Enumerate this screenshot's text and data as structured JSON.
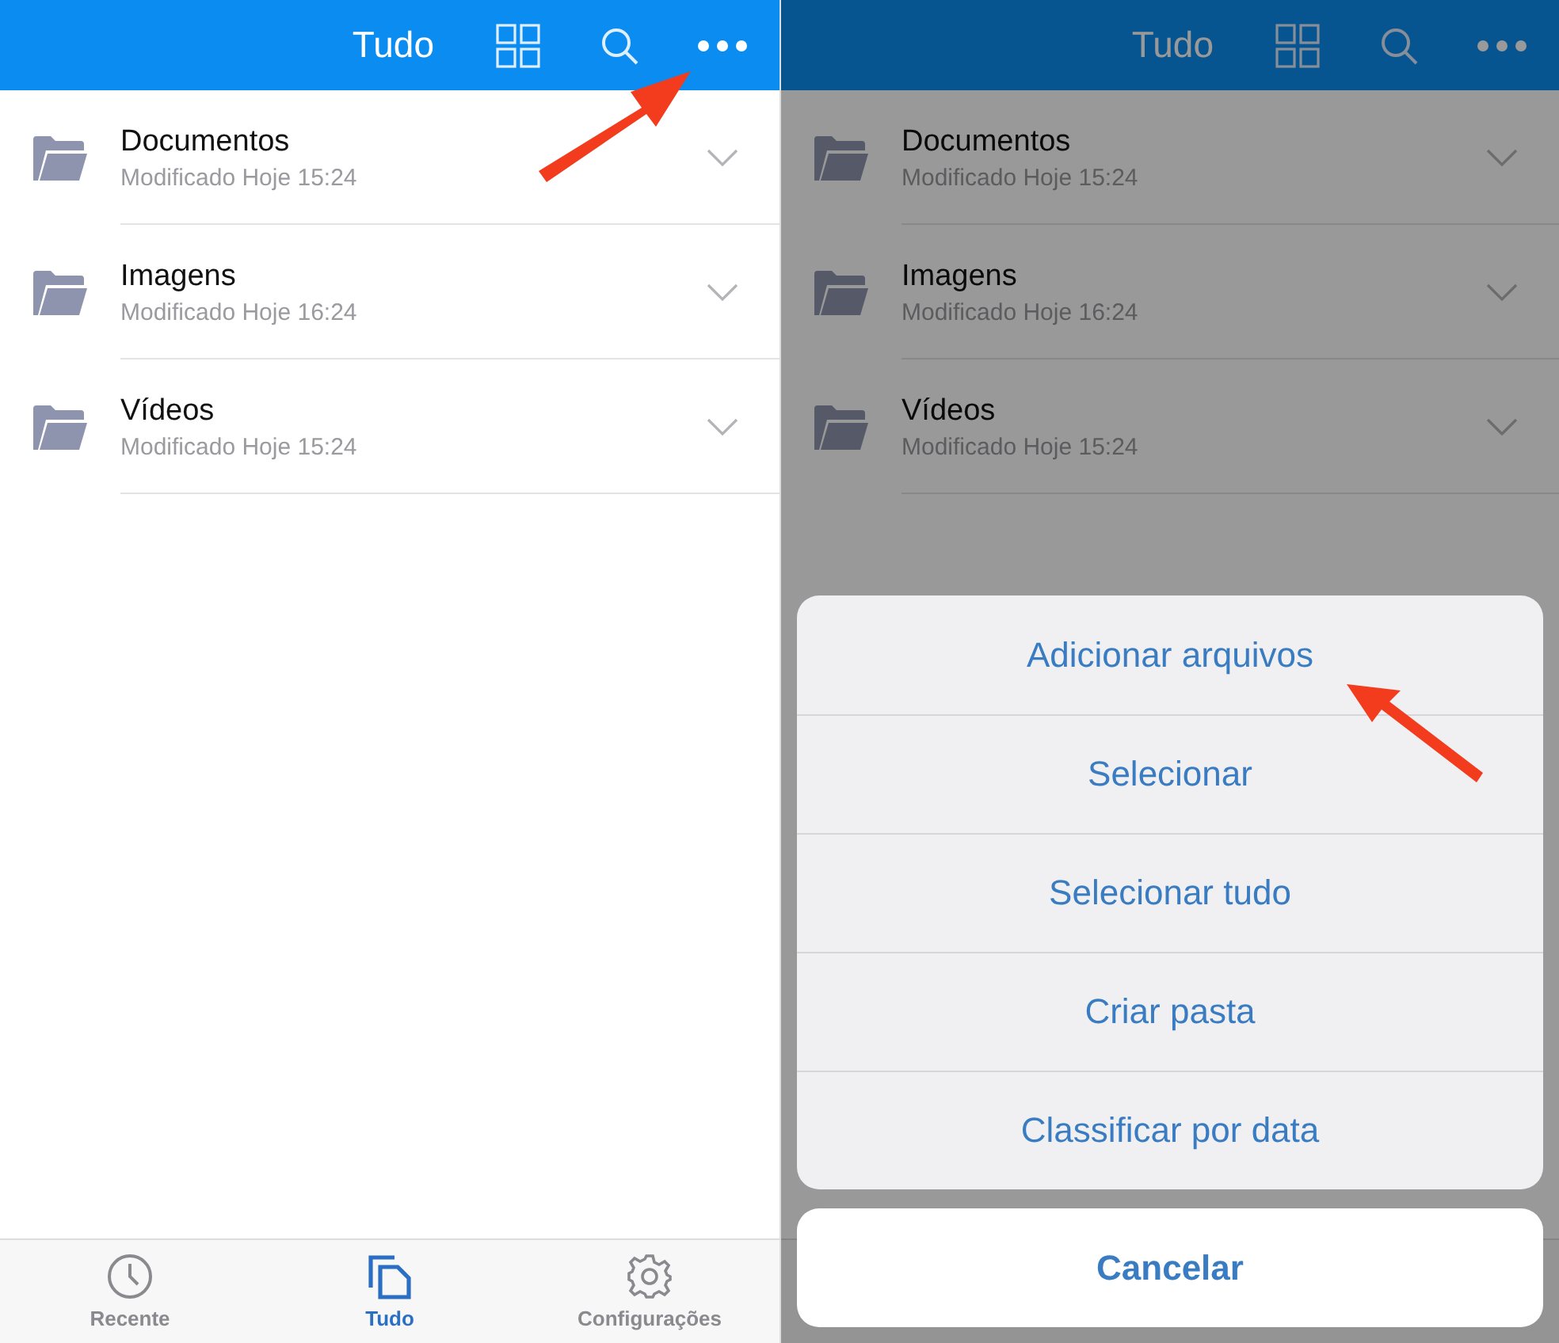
{
  "screens": [
    {
      "header": {
        "title": "Tudo"
      },
      "folders": [
        {
          "name": "Documentos",
          "modified": "Modificado Hoje 15:24"
        },
        {
          "name": "Imagens",
          "modified": "Modificado Hoje 16:24"
        },
        {
          "name": "Vídeos",
          "modified": "Modificado Hoje 15:24"
        }
      ],
      "tab_bar": [
        {
          "label": "Recente",
          "kind": "clock",
          "selected": false
        },
        {
          "label": "Tudo",
          "kind": "files",
          "selected": true
        },
        {
          "label": "Configurações",
          "kind": "gear",
          "selected": false
        }
      ]
    },
    {
      "header": {
        "title": "Tudo"
      },
      "folders": [
        {
          "name": "Documentos",
          "modified": "Modificado Hoje 15:24"
        },
        {
          "name": "Imagens",
          "modified": "Modificado Hoje 16:24"
        },
        {
          "name": "Vídeos",
          "modified": "Modificado Hoje 15:24"
        }
      ],
      "action_sheet": {
        "actions": [
          "Adicionar arquivos",
          "Selecionar",
          "Selecionar tudo",
          "Criar pasta",
          "Classificar por data"
        ],
        "cancel": "Cancelar"
      }
    }
  ]
}
